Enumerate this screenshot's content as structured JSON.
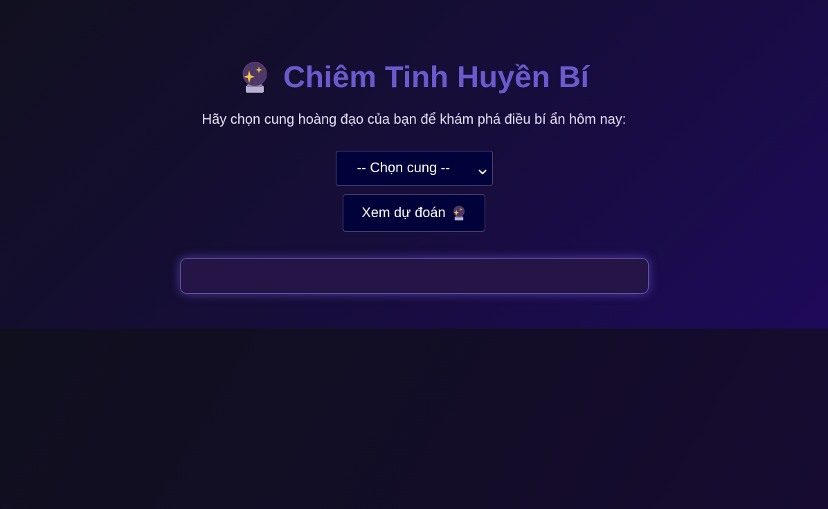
{
  "header": {
    "title": "Chiêm Tinh Huyền Bí",
    "title_icon": "crystal-ball-icon"
  },
  "prompt": {
    "text": "Hãy chọn cung hoàng đạo của bạn để khám phá điều bí ẩn hôm nay:"
  },
  "zodiac_select": {
    "selected_label": "-- Chọn cung --",
    "icon": "chevron-down-icon"
  },
  "predict_button": {
    "label": "Xem dự đoán",
    "icon": "crystal-ball-icon"
  },
  "result": {
    "text": ""
  },
  "colors": {
    "title": "#6a5acd",
    "background_dark": "#11101f",
    "background_purple": "#1e0a5a",
    "control_bg": "#01023a",
    "result_border": "#6654b0"
  }
}
